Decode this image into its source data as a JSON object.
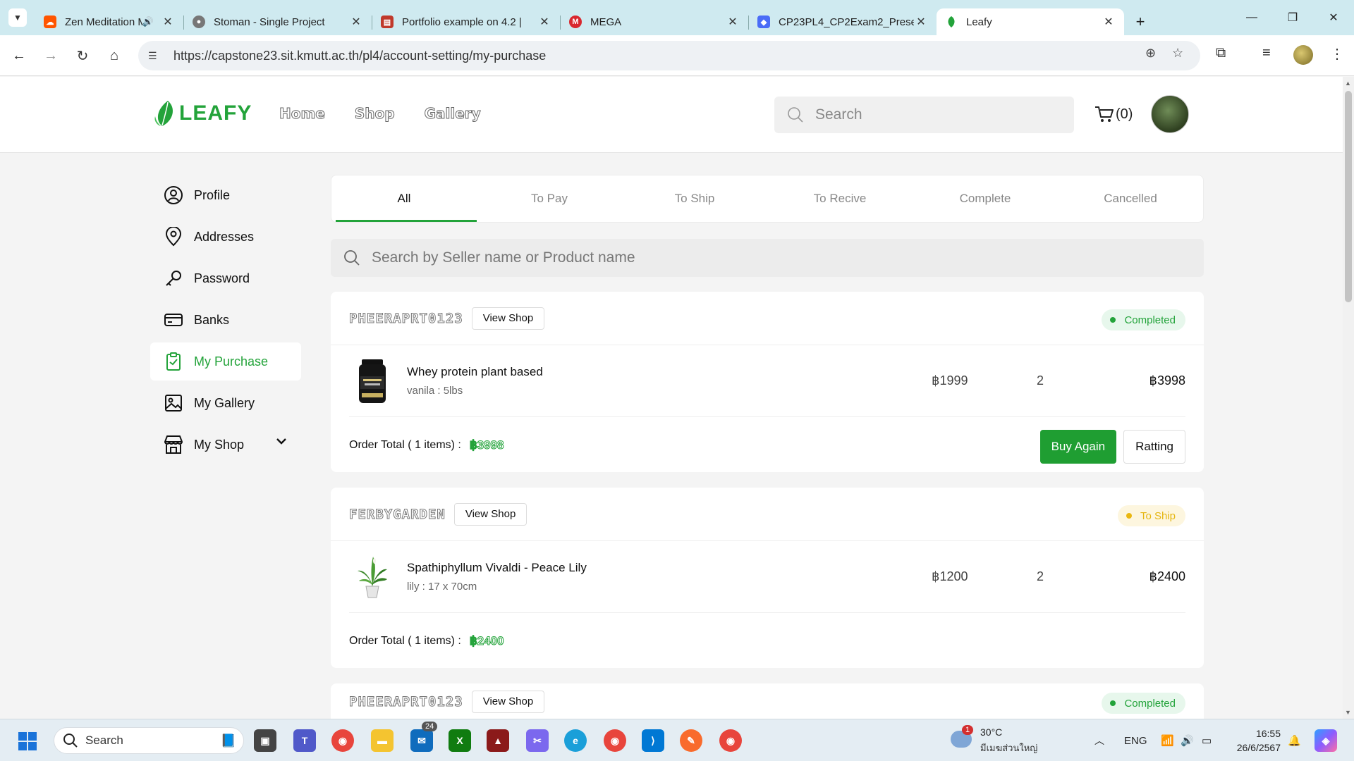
{
  "browser": {
    "tabs": [
      {
        "title": "Zen Meditation Music |",
        "favicon": "soundcloud-icon",
        "color": "#ff5500",
        "audio": true
      },
      {
        "title": "Stoman - Single Project",
        "favicon": "globe-icon",
        "color": "#666666"
      },
      {
        "title": "Portfolio example on 4.2 | ",
        "favicon": "document-icon",
        "color": "#c0392b"
      },
      {
        "title": "MEGA",
        "favicon": "mega-icon",
        "color": "#d9272e"
      },
      {
        "title": "CP23PL4_CP2Exam2_Prese",
        "favicon": "canva-icon",
        "color": "#4a6cf7"
      },
      {
        "title": "Leafy",
        "favicon": "leaf-icon",
        "color": "#23a33a",
        "active": true
      }
    ],
    "url": "https://capstone23.sit.kmutt.ac.th/pl4/account-setting/my-purchase"
  },
  "site": {
    "logo_text": "LEAFY",
    "nav": [
      "Home",
      "Shop",
      "Gallery"
    ],
    "search_placeholder": "Search",
    "cart_count": "(0)"
  },
  "sidebar": {
    "items": [
      {
        "label": "Profile",
        "icon": "user-circle-icon"
      },
      {
        "label": "Addresses",
        "icon": "map-pin-icon"
      },
      {
        "label": "Password",
        "icon": "key-icon"
      },
      {
        "label": "Banks",
        "icon": "credit-card-icon"
      },
      {
        "label": "My Purchase",
        "icon": "clipboard-icon",
        "active": true
      },
      {
        "label": "My Gallery",
        "icon": "image-icon"
      },
      {
        "label": "My Shop",
        "icon": "store-icon",
        "expandable": true
      }
    ]
  },
  "purchase": {
    "tabs": [
      "All",
      "To Pay",
      "To Ship",
      "To Recive",
      "Complete",
      "Cancelled"
    ],
    "active_tab": "All",
    "search_placeholder": "Search by Seller name or Product name",
    "view_shop_label": "View Shop",
    "order_total_label": "Order Total ( 1 items) :",
    "orders": [
      {
        "seller": "PHEERAPRT0123",
        "status": "Completed",
        "status_color": "#23a33a",
        "item": {
          "name": "Whey protein plant based",
          "variant": "vanila : 5lbs",
          "price": "฿1999",
          "qty": "2",
          "subtotal": "฿3998"
        },
        "total": "฿3998",
        "buttons": {
          "buy_again": "Buy Again",
          "rate": "Ratting"
        }
      },
      {
        "seller": "FERBYGARDEN",
        "status": "To Ship",
        "status_color": "#eab711",
        "item": {
          "name": "Spathiphyllum Vivaldi - Peace Lily",
          "variant": "lily : 17 x 70cm",
          "price": "฿1200",
          "qty": "2",
          "subtotal": "฿2400"
        },
        "total": "฿2400"
      },
      {
        "seller": "PHEERAPRT0123",
        "status": "Completed",
        "status_color": "#23a33a"
      }
    ]
  },
  "taskbar": {
    "search_label": "Search",
    "mail_badge": "24",
    "weather_temp": "30°C",
    "weather_location": "มีเมฆส่วนใหญ่",
    "weather_badge": "1",
    "lang": "ENG",
    "time": "16:55",
    "date": "26/6/2567"
  }
}
